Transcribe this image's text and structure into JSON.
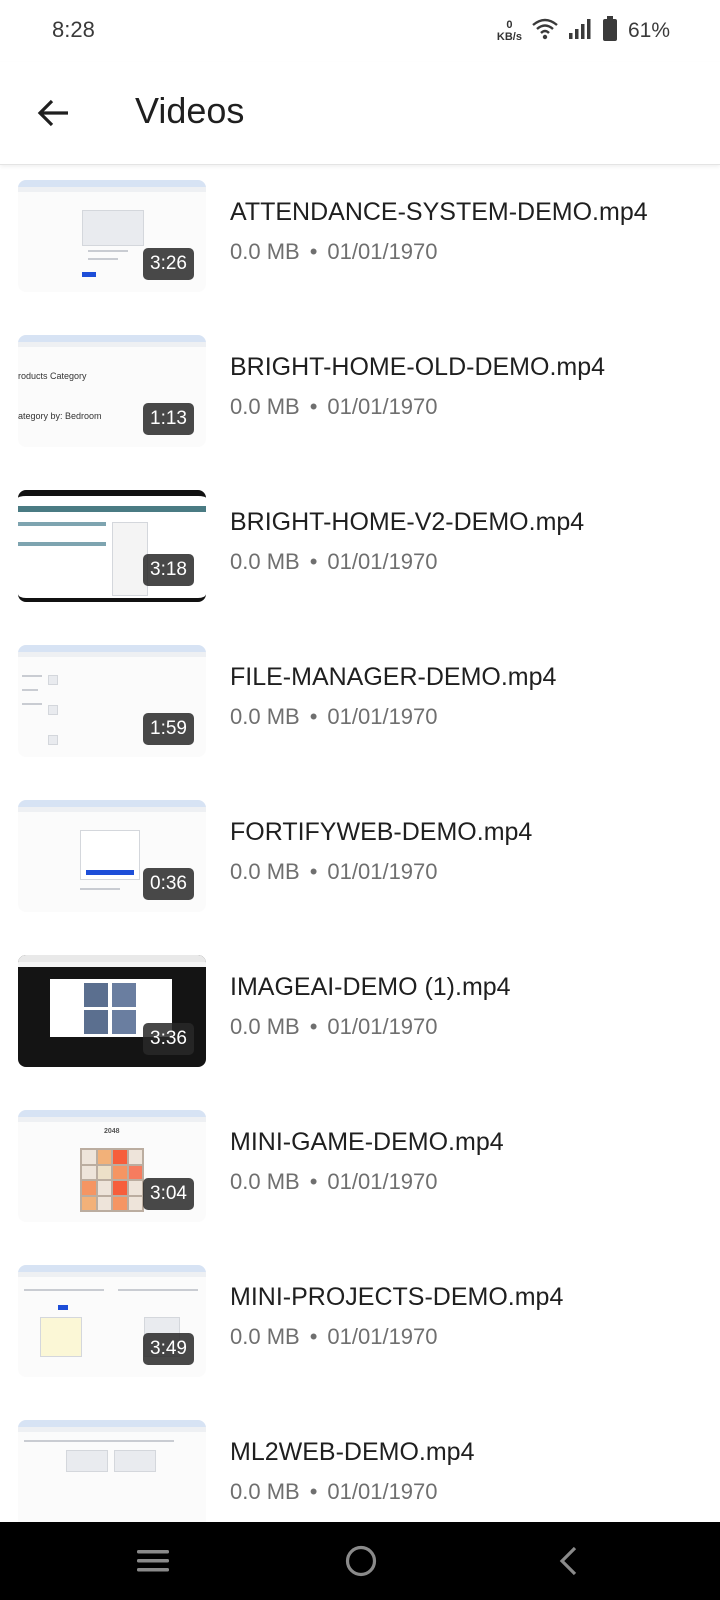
{
  "status_bar": {
    "time": "8:28",
    "net_speed_value": "0",
    "net_speed_unit": "KB/s",
    "wifi_icon": "wifi-icon",
    "signal_icon": "signal-icon",
    "battery_icon": "battery-icon",
    "battery_percent": "61%"
  },
  "app_bar": {
    "back_icon": "arrow-left-icon",
    "title": "Videos"
  },
  "videos": [
    {
      "title": "ATTENDANCE-SYSTEM-DEMO.mp4",
      "size": "0.0 MB",
      "date": "01/01/1970",
      "duration": "3:26"
    },
    {
      "title": "BRIGHT-HOME-OLD-DEMO.mp4",
      "size": "0.0 MB",
      "date": "01/01/1970",
      "duration": "1:13"
    },
    {
      "title": "BRIGHT-HOME-V2-DEMO.mp4",
      "size": "0.0 MB",
      "date": "01/01/1970",
      "duration": "3:18"
    },
    {
      "title": "FILE-MANAGER-DEMO.mp4",
      "size": "0.0 MB",
      "date": "01/01/1970",
      "duration": "1:59"
    },
    {
      "title": "FORTIFYWEB-DEMO.mp4",
      "size": "0.0 MB",
      "date": "01/01/1970",
      "duration": "0:36"
    },
    {
      "title": "IMAGEAI-DEMO (1).mp4",
      "size": "0.0 MB",
      "date": "01/01/1970",
      "duration": "3:36"
    },
    {
      "title": "MINI-GAME-DEMO.mp4",
      "size": "0.0 MB",
      "date": "01/01/1970",
      "duration": "3:04"
    },
    {
      "title": "MINI-PROJECTS-DEMO.mp4",
      "size": "0.0 MB",
      "date": "01/01/1970",
      "duration": "3:49"
    },
    {
      "title": "ML2WEB-DEMO.mp4",
      "size": "0.0 MB",
      "date": "01/01/1970",
      "duration": ""
    }
  ],
  "meta_separator": "•",
  "thumb_text": {
    "bright_home_heading": "roducts Category",
    "bright_home_sub": "ategory by: Bedroom",
    "game_title": "2048"
  },
  "nav_bar": {
    "recents_icon": "recents-icon",
    "home_icon": "home-icon",
    "back_icon": "back-triangle-icon"
  },
  "colors": {
    "title_text": "#1f1f1f",
    "meta_text": "#6f6f6f",
    "duration_badge": "#282828",
    "nav_bar": "#000000"
  }
}
